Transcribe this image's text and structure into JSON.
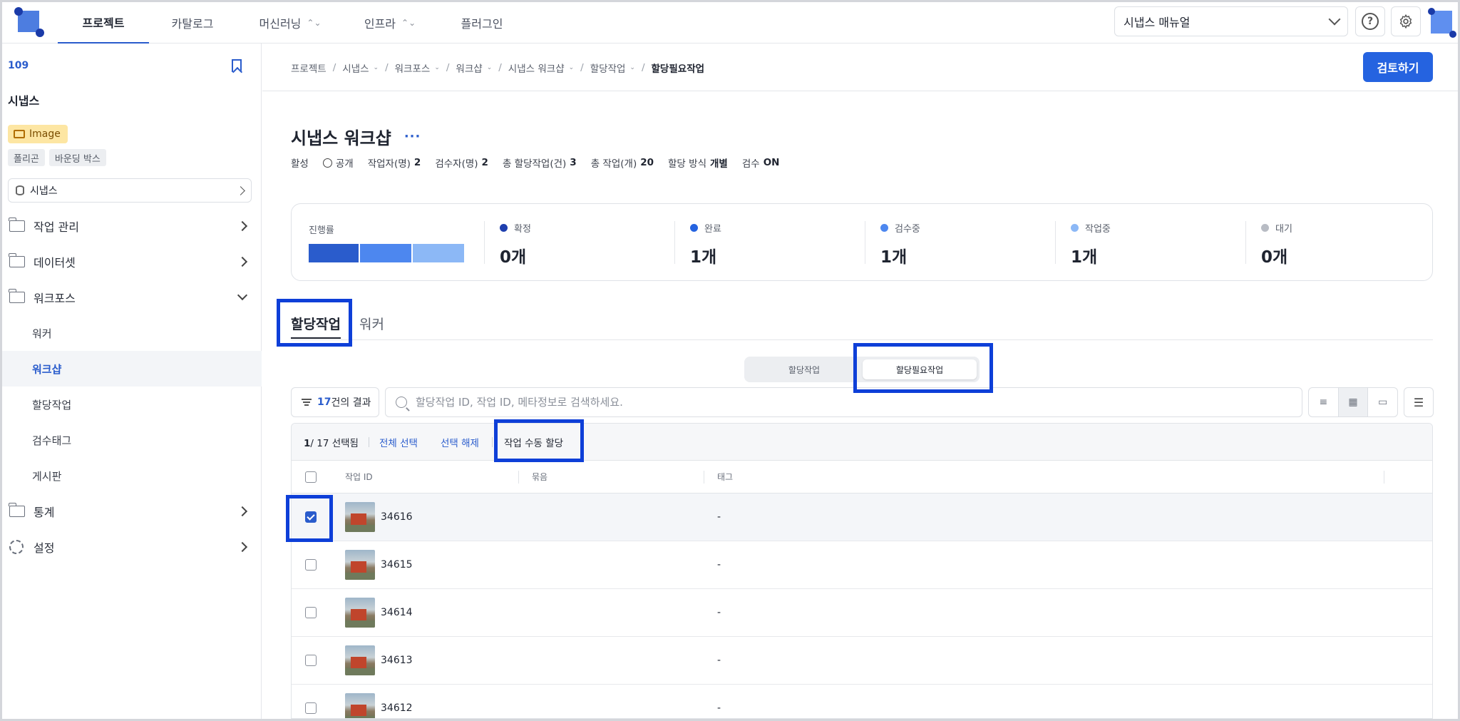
{
  "topnav": {
    "tabs": [
      {
        "label": "프로젝트",
        "has_dropdown": false,
        "active": true
      },
      {
        "label": "카탈로그",
        "has_dropdown": false
      },
      {
        "label": "머신러닝",
        "has_dropdown": true
      },
      {
        "label": "인프라",
        "has_dropdown": true
      },
      {
        "label": "플러그인",
        "has_dropdown": false
      }
    ],
    "manual_select": "시냅스 매뉴얼",
    "help_icon": "?"
  },
  "sidebar": {
    "project_number": "109",
    "project_name": "시냅스",
    "data_type_badge": "Image",
    "annotation_types": [
      "폴리곤",
      "바운딩 박스"
    ],
    "dataset_select": "시냅스",
    "menu": [
      {
        "label": "작업 관리",
        "icon": "folder-icon",
        "expanded": false
      },
      {
        "label": "데이터셋",
        "icon": "folder-icon",
        "expanded": false
      },
      {
        "label": "워크포스",
        "icon": "folder-icon",
        "expanded": true,
        "children": [
          "워커",
          "워크샵",
          "할당작업",
          "검수태그",
          "게시판"
        ]
      },
      {
        "label": "통계",
        "icon": "folder-icon",
        "expanded": false
      },
      {
        "label": "설정",
        "icon": "gear-icon",
        "expanded": false
      }
    ],
    "active_child": "워크샵"
  },
  "breadcrumb": [
    "프로젝트",
    "시냅스",
    "워크포스",
    "워크샵",
    "시냅스 워크샵",
    "할당작업",
    "할당필요작업"
  ],
  "review_button": "검토하기",
  "workshop": {
    "title": "시냅스 워크샵",
    "more": "···",
    "meta": {
      "status": "활성",
      "visibility": "공개",
      "workers_label": "작업자(명)",
      "workers": "2",
      "reviewers_label": "검수자(명)",
      "reviewers": "2",
      "assignments_label": "총 할당작업(건)",
      "assignments": "3",
      "tasks_label": "총 작업(개)",
      "tasks": "20",
      "method_label": "할당 방식",
      "method": "개별",
      "review_label": "검수",
      "review": "ON"
    }
  },
  "stats": {
    "progress_label": "진행률",
    "progress_segments": [
      {
        "status": "완료",
        "color": "#2a5ccc"
      },
      {
        "status": "검수중",
        "color": "#4d87ef"
      },
      {
        "status": "작업중",
        "color": "#8cb8f6"
      }
    ],
    "items": [
      {
        "label": "확정",
        "value": "0개",
        "color": "#1e3fae"
      },
      {
        "label": "완료",
        "value": "1개",
        "color": "#2563e0"
      },
      {
        "label": "검수중",
        "value": "1개",
        "color": "#4d87ef"
      },
      {
        "label": "작업중",
        "value": "1개",
        "color": "#8cb8f6"
      },
      {
        "label": "대기",
        "value": "0개",
        "color": "#b8bcc4"
      }
    ]
  },
  "tabs": [
    "할당작업",
    "워커"
  ],
  "segments": [
    "할당작업",
    "할당필요작업"
  ],
  "toolbar": {
    "result_count": "17",
    "result_suffix": "건의 결과",
    "search_placeholder": "할당작업 ID, 작업 ID, 메타정보로 검색하세요."
  },
  "selection": {
    "selected": "1",
    "total": "/ 17 선택됨",
    "select_all": "전체 선택",
    "deselect": "선택 해제",
    "manual_assign": "작업 수동 할당"
  },
  "table": {
    "columns": [
      "작업 ID",
      "묶음",
      "태그"
    ],
    "rows": [
      {
        "id": "34616",
        "group": "",
        "tag": "-",
        "checked": true
      },
      {
        "id": "34615",
        "group": "",
        "tag": "-",
        "checked": false
      },
      {
        "id": "34614",
        "group": "",
        "tag": "-",
        "checked": false
      },
      {
        "id": "34613",
        "group": "",
        "tag": "-",
        "checked": false
      },
      {
        "id": "34612",
        "group": "",
        "tag": "-",
        "checked": false
      }
    ]
  },
  "colors": {
    "accent": "#2563e0",
    "highlight_box": "#0e3fd8"
  }
}
